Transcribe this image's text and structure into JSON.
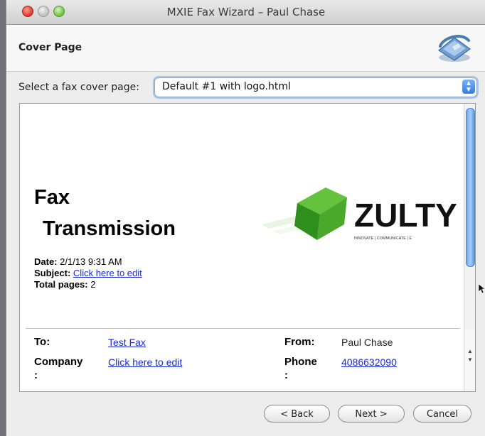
{
  "window": {
    "title": "MXIE Fax Wizard – Paul Chase"
  },
  "header": {
    "title": "Cover Page"
  },
  "cover_select": {
    "label": "Select a fax cover page:",
    "value": "Default #1 with logo.html"
  },
  "preview": {
    "heading_line1": "Fax",
    "heading_line2": "Transmission",
    "logo_text": "ZULTY",
    "logo_tagline": "INNOVATE | COMMUNICATE | E",
    "date_label": "Date:",
    "date_value": "2/1/13 9:31 AM",
    "subject_label": "Subject:",
    "subject_value": "Click here to edit",
    "pages_label": "Total pages:",
    "pages_value": "2",
    "to_label": "To:",
    "to_value": "Test Fax",
    "company_label": "Company",
    "company_colon": ":",
    "company_value": "Click here to edit",
    "from_label": "From:",
    "from_value": "Paul Chase",
    "phone_label": "Phone",
    "phone_colon": ":",
    "phone_value": "4086632090"
  },
  "buttons": {
    "back": "< Back",
    "next": "Next >",
    "cancel": "Cancel"
  },
  "colors": {
    "link": "#1a2ad6",
    "select_focus": "#a9c6ea",
    "logo_green": "#3fae2a"
  }
}
